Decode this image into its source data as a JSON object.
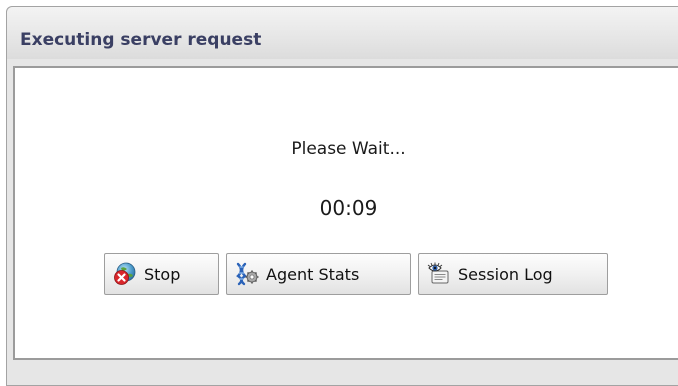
{
  "dialog": {
    "title": "Executing server request",
    "message": "Please Wait...",
    "elapsed_time": "00:09"
  },
  "buttons": {
    "stop_label": "Stop",
    "agent_stats_label": "Agent Stats",
    "session_log_label": "Session Log"
  },
  "icons": {
    "stop": "stop-globe-icon",
    "agent_stats": "agent-stats-icon",
    "session_log": "session-log-icon"
  },
  "colors": {
    "title_text": "#3a3f63",
    "stop_badge": "#d9262b"
  }
}
